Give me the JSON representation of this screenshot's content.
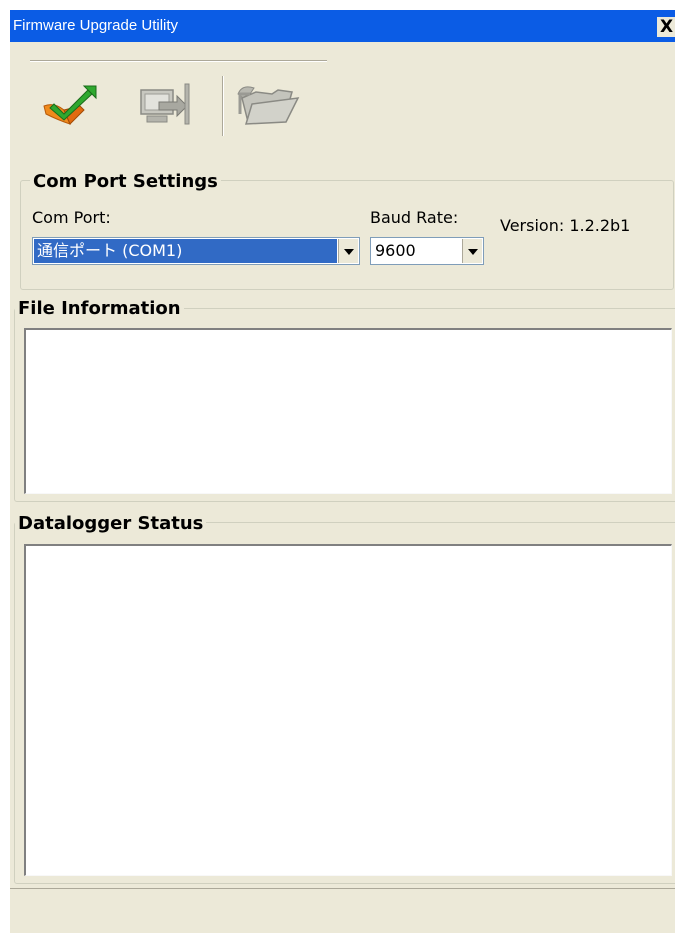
{
  "window": {
    "title": "Firmware Upgrade Utility",
    "close_label": "X"
  },
  "toolbar": {
    "buttons": [
      {
        "icon": "upgrade-check-icon"
      },
      {
        "icon": "computer-transfer-icon"
      },
      {
        "icon": "open-folder-icon"
      }
    ]
  },
  "com_port_settings": {
    "title": "Com Port Settings",
    "com_port_label": "Com Port:",
    "com_port_value": "通信ポート (COM1)",
    "baud_rate_label": "Baud Rate:",
    "baud_rate_value": "9600",
    "version": "Version: 1.2.2b1"
  },
  "file_information": {
    "title": "File Information"
  },
  "datalogger_status": {
    "title": "Datalogger Status"
  },
  "colors": {
    "titlebar": "#0b5ce5",
    "window_bg": "#ece9d8",
    "selection": "#316ac5"
  }
}
